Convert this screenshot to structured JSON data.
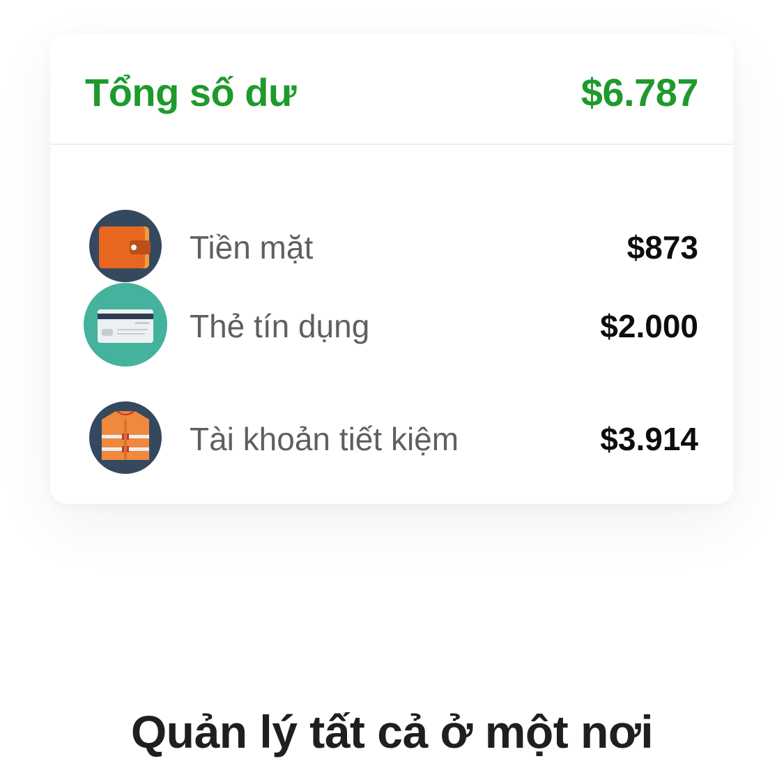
{
  "balance_card": {
    "total_label": "Tổng số dư",
    "total_value": "$6.787",
    "accent_color": "#1e9a2c",
    "accounts": [
      {
        "label": "Tiền mặt",
        "value": "$873",
        "icon": "wallet-icon"
      },
      {
        "label": "Thẻ tín dụng",
        "value": "$2.000",
        "icon": "credit-card-icon"
      },
      {
        "label": "Tài khoản tiết kiệm",
        "value": "$3.914",
        "icon": "life-vest-icon"
      }
    ]
  },
  "tagline": "Quản lý tất cả ở một nơi"
}
